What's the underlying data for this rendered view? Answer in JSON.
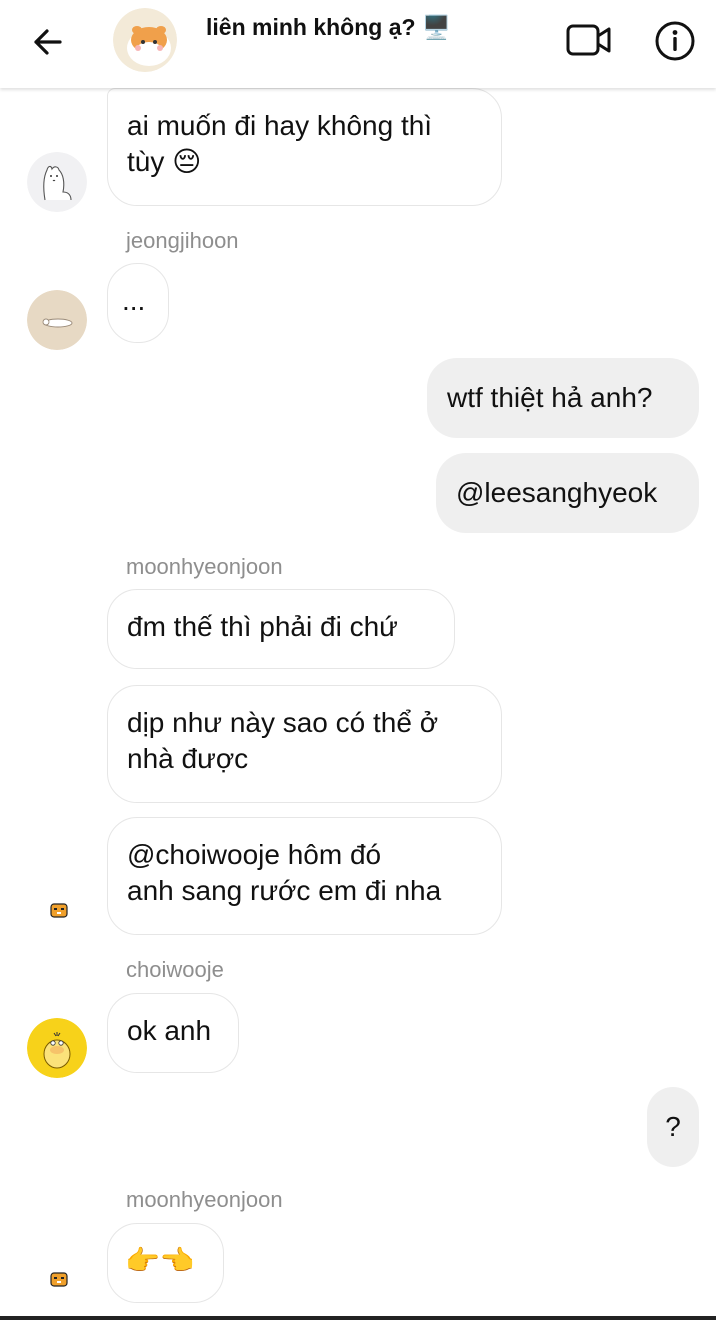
{
  "header": {
    "title": "liên minh không ạ? 🖥️",
    "back_icon": "arrow-left-icon",
    "video_icon": "video-camera-icon",
    "info_icon": "info-icon"
  },
  "messages": [
    {
      "text": "ai muốn đi hay không thì\ntùy 😔"
    },
    {
      "sender": "jeongjihoon"
    },
    {
      "text": "..."
    },
    {
      "text": "wtf thiệt hả anh?"
    },
    {
      "text": "@leesanghyeok"
    },
    {
      "sender": "moonhyeonjoon"
    },
    {
      "text": "đm thế thì phải đi chứ"
    },
    {
      "text": "dịp như này sao có thể ở\nnhà được"
    },
    {
      "text": "@choiwooje  hôm đó\nanh sang rước em đi nha"
    },
    {
      "sender": "choiwooje"
    },
    {
      "text": "ok anh"
    },
    {
      "text": "?"
    },
    {
      "sender": "moonhyeonjoon"
    },
    {
      "text": "👉👈"
    }
  ],
  "colors": {
    "incoming_bg": "#ffffff",
    "incoming_border": "#e6e6e6",
    "outgoing_bg": "#efefef",
    "sender_label": "#8e8e8e"
  }
}
